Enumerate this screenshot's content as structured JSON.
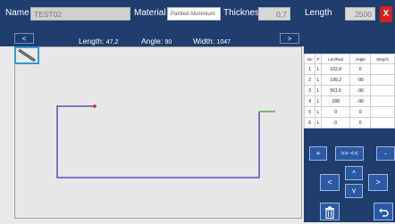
{
  "header": {
    "name_label": "Name",
    "name_value": "TEST02",
    "material_label": "Material",
    "material_value": "Painted Aluminium",
    "thickness_label": "Thickness",
    "thickness_value": "0,7",
    "length_label": "Length",
    "length_value": "2500",
    "close_label": "X"
  },
  "info_bar": {
    "prev_label": "<",
    "next_label": ">",
    "length_label": "Length:",
    "length_value": "47,2",
    "angle_label": "Angle:",
    "angle_value": "90",
    "width_label": "Width:",
    "width_value": "1047"
  },
  "table": {
    "headers": [
      "No",
      "F",
      "Len/Rad",
      "Angle",
      "Step/G"
    ],
    "rows": [
      [
        "1",
        "L",
        "102,4",
        "0",
        ""
      ],
      [
        "2",
        "L",
        "199,2",
        "-90",
        ""
      ],
      [
        "3",
        "L",
        "561,6",
        "-90",
        ""
      ],
      [
        "4",
        "L",
        "188",
        "-90",
        ""
      ],
      [
        "5",
        "L",
        "0",
        "0",
        ""
      ],
      [
        "6",
        "L",
        "0",
        "0",
        ""
      ]
    ]
  },
  "controls": {
    "add_label": "+",
    "flip_label": ">> <<",
    "remove_label": "-",
    "left_label": "<",
    "up_label": "^",
    "down_label": "v",
    "right_label": ">"
  },
  "colors": {
    "header_bg": "#1f3d6d",
    "profile_line": "#3b3bb0",
    "start_marker": "#e02020",
    "end_segment": "#2e9b2e",
    "close_button": "#d72020"
  }
}
